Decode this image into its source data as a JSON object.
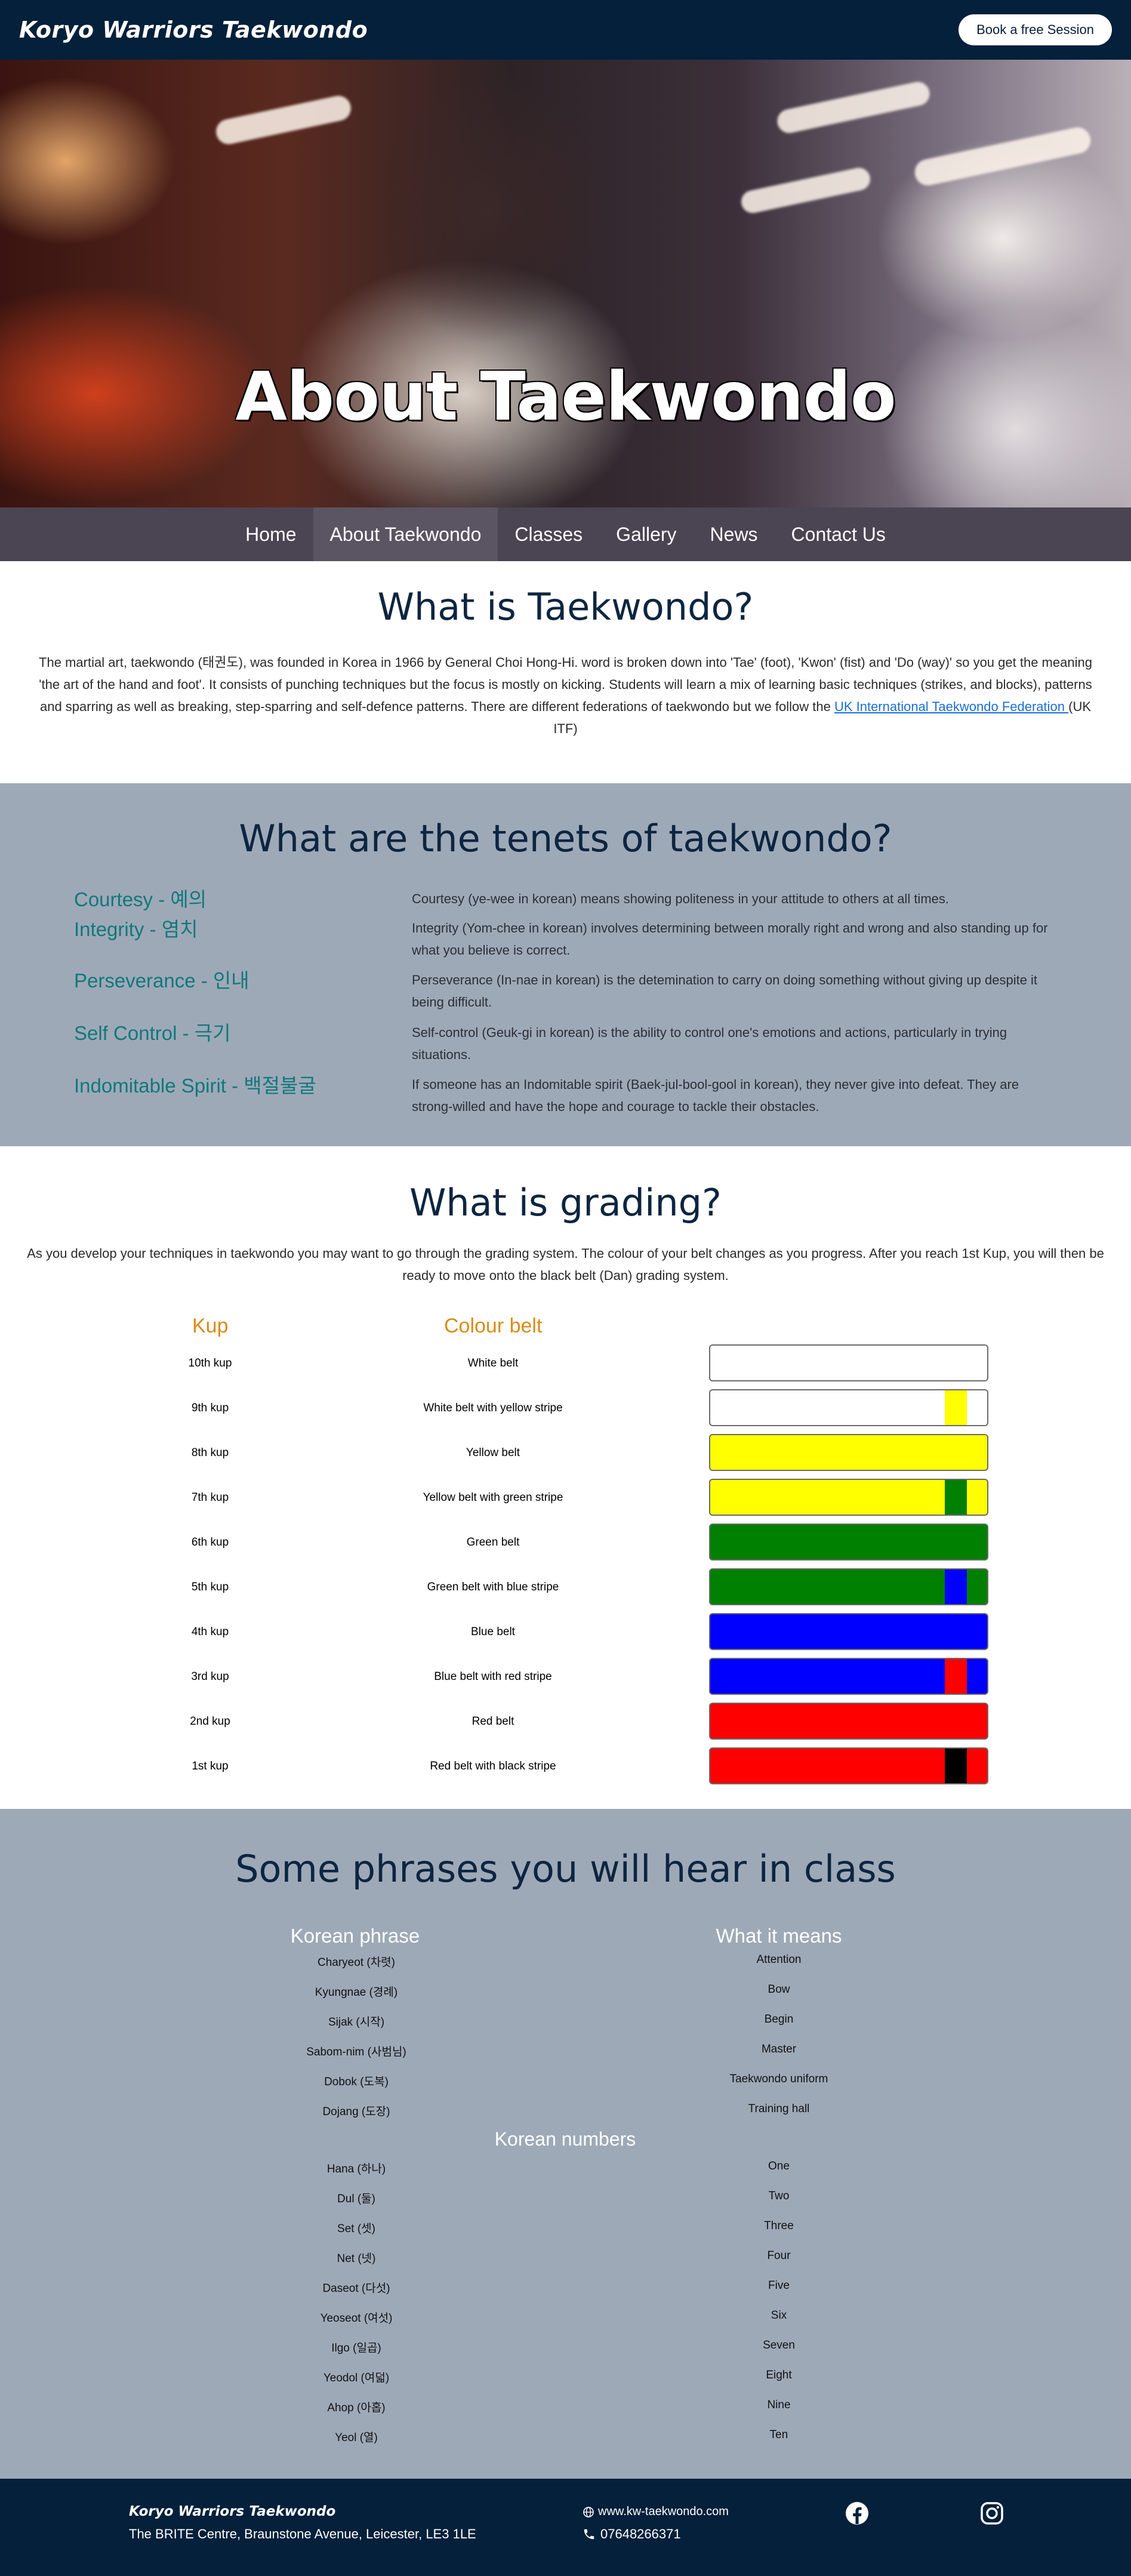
{
  "header": {
    "brand": "Koryo Warriors Taekwondo",
    "cta_label": "Book a free Session"
  },
  "hero": {
    "title": "About Taekwondo"
  },
  "nav": {
    "items": [
      "Home",
      "About Taekwondo",
      "Classes",
      "Gallery",
      "News",
      "Contact Us"
    ],
    "active": "About Taekwondo"
  },
  "what_is": {
    "title": "What is Taekwondo?",
    "body": "The martial art, taekwondo (태권도), was founded in Korea in 1966 by General Choi Hong-Hi. word is broken down into 'Tae' (foot), 'Kwon' (fist) and 'Do (way)' so you get the meaning 'the art of the hand and foot'. It consists of punching techniques but the focus is mostly on kicking. Students will learn a mix of learning basic techniques (strikes, and blocks), patterns and sparring as well as breaking, step-sparring and self-defence patterns. There are different federations of taekwondo but we follow the ",
    "link_text": "UK International Taekwondo Federation ",
    "suffix": "(UK ITF)"
  },
  "tenets": {
    "title": "What are the tenets of taekwondo?",
    "names": [
      "Courtesy - 예의",
      "Integrity - 염치",
      "Perseverance - 인내",
      "Self Control - 극기",
      "Indomitable Spirit - 백절불굴"
    ],
    "descriptions": [
      "Courtesy (ye-wee in korean) means showing politeness in your attitude to others at all times.",
      "Integrity (Yom-chee in korean) involves determining between morally right and wrong and also standing up for what you believe is correct.",
      "Perseverance (In-nae in korean) is the detemination to carry on doing something without giving up despite it being difficult.",
      "Self-control (Geuk-gi in korean) is the ability to control one's emotions and actions, particularly in trying situations.",
      "If someone has an Indomitable spirit (Baek-jul-bool-gool in korean), they never give into defeat. They are strong-willed and have the hope and courage to tackle their obstacles."
    ]
  },
  "grading": {
    "title": "What is grading?",
    "body": "As you develop your techniques in taekwondo you may want to go through the grading system. The colour of your belt changes as you progress. After you reach 1st Kup, you will then be ready to move onto the black belt (Dan) grading system.",
    "col_kup": "Kup",
    "col_belt": "Colour belt",
    "rows": [
      {
        "kup": "10th kup",
        "belt": "White belt",
        "color": "#ffffff",
        "stripe": ""
      },
      {
        "kup": "9th kup",
        "belt": "White belt with yellow stripe",
        "color": "#ffffff",
        "stripe": "#ffff00"
      },
      {
        "kup": "8th kup",
        "belt": "Yellow belt",
        "color": "#ffff00",
        "stripe": ""
      },
      {
        "kup": "7th kup",
        "belt": "Yellow belt with green stripe",
        "color": "#ffff00",
        "stripe": "#008000"
      },
      {
        "kup": "6th kup",
        "belt": "Green belt",
        "color": "#008000",
        "stripe": ""
      },
      {
        "kup": "5th kup",
        "belt": "Green belt with blue stripe",
        "color": "#008000",
        "stripe": "#0000ff"
      },
      {
        "kup": "4th kup",
        "belt": "Blue belt",
        "color": "#0000ff",
        "stripe": ""
      },
      {
        "kup": "3rd kup",
        "belt": "Blue belt with red stripe",
        "color": "#0000ff",
        "stripe": "#ff0000"
      },
      {
        "kup": "2nd kup",
        "belt": "Red belt",
        "color": "#ff0000",
        "stripe": ""
      },
      {
        "kup": "1st kup",
        "belt": "Red belt with black stripe",
        "color": "#ff0000",
        "stripe": "#000000"
      }
    ]
  },
  "phrases": {
    "title": "Some phrases you will hear in class",
    "col_korean": "Korean phrase",
    "col_meaning": "What it means",
    "items": [
      {
        "korean": "Charyeot (차렷)",
        "meaning": "Attention"
      },
      {
        "korean": "Kyungnae (경례)",
        "meaning": "Bow"
      },
      {
        "korean": "Sijak (시작)",
        "meaning": "Begin"
      },
      {
        "korean": "Sabom-nim (사범님)",
        "meaning": "Master"
      },
      {
        "korean": "Dobok (도복)",
        "meaning": "Taekwondo uniform"
      },
      {
        "korean": "Dojang (도장)",
        "meaning": "Training hall"
      }
    ],
    "numbers_title": "Korean numbers",
    "numbers": [
      {
        "korean": "Hana (하나)",
        "meaning": "One"
      },
      {
        "korean": "Dul (둘)",
        "meaning": "Two"
      },
      {
        "korean": "Set (셋)",
        "meaning": "Three"
      },
      {
        "korean": "Net (넷)",
        "meaning": "Four"
      },
      {
        "korean": "Daseot (다섯)",
        "meaning": "Five"
      },
      {
        "korean": "Yeoseot (여섯)",
        "meaning": "Six"
      },
      {
        "korean": "Ilgo (일곱)",
        "meaning": "Seven"
      },
      {
        "korean": "Yeodol (여덟)",
        "meaning": "Eight"
      },
      {
        "korean": "Ahop (아홉)",
        "meaning": "Nine"
      },
      {
        "korean": "Yeol (열)",
        "meaning": "Ten"
      }
    ]
  },
  "footer": {
    "brand": "Koryo Warriors Taekwondo",
    "address": "The BRITE Centre, Braunstone Avenue, Leicester, LE3 1LE",
    "website": "www.kw-taekwondo.com",
    "phone": "07648266371"
  },
  "icons": {
    "globe": "globe-icon",
    "phone": "phone-icon",
    "facebook": "facebook-icon",
    "instagram": "instagram-icon"
  }
}
